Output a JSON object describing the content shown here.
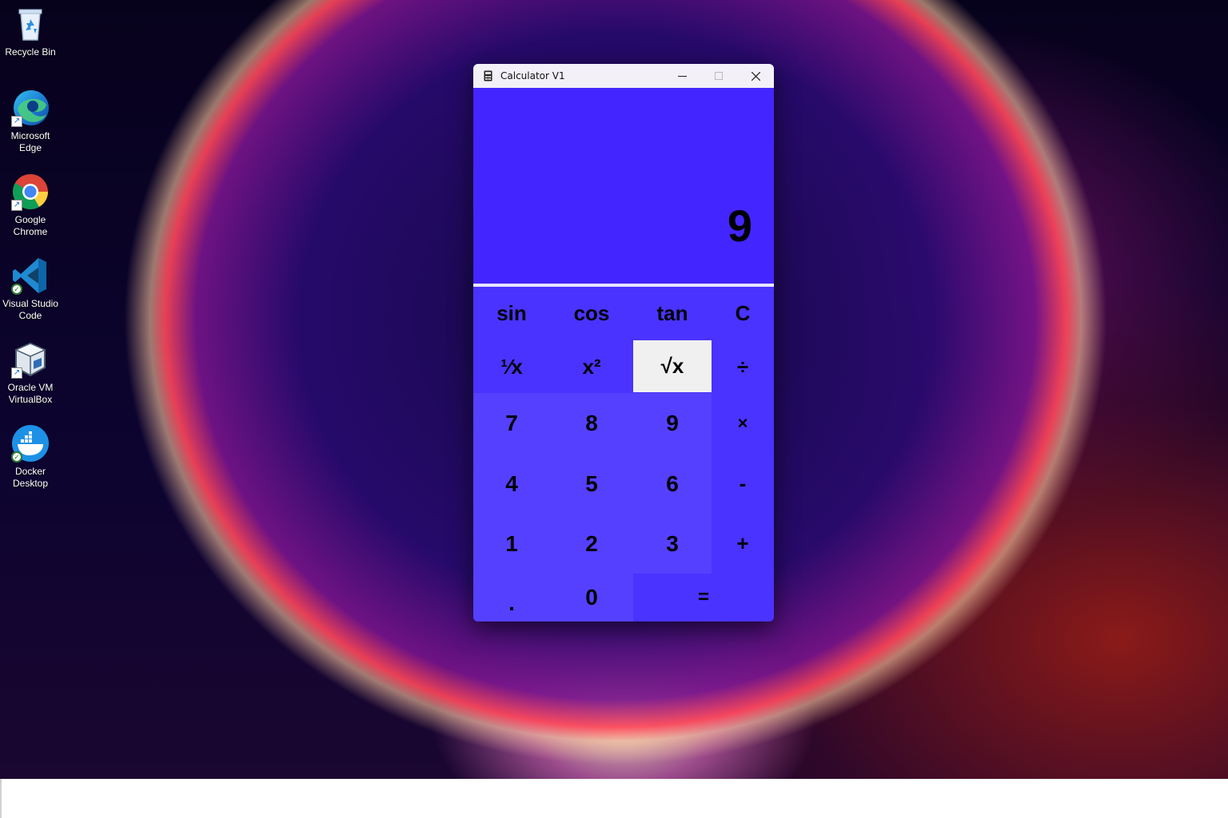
{
  "desktop": {
    "icons": [
      {
        "label": "Recycle Bin",
        "icon": "recycle-bin-icon"
      },
      {
        "label": "Microsoft Edge",
        "icon": "edge-icon"
      },
      {
        "label": "Google Chrome",
        "icon": "chrome-icon"
      },
      {
        "label": "Visual Studio Code",
        "icon": "vscode-icon"
      },
      {
        "label": "Oracle VM VirtualBox",
        "icon": "virtualbox-icon"
      },
      {
        "label": "Docker Desktop",
        "icon": "docker-icon"
      }
    ]
  },
  "window": {
    "title": "Calculator V1",
    "icon": "calculator-icon",
    "minimize": "—",
    "maximize": "☐",
    "close": "✕"
  },
  "display": {
    "value": "9"
  },
  "keys": {
    "sin": "sin",
    "cos": "cos",
    "tan": "tan",
    "clear": "C",
    "reciprocal": "¹⁄x",
    "square": "x²",
    "sqrt": "√x",
    "divide": "÷",
    "seven": "7",
    "eight": "8",
    "nine": "9",
    "multiply": "×",
    "four": "4",
    "five": "5",
    "six": "6",
    "minus": "-",
    "one": "1",
    "two": "2",
    "three": "3",
    "plus": "+",
    "dot": ".",
    "zero": "0",
    "equals": "="
  },
  "colors": {
    "display_bg": "#4326ff",
    "keypad_bg": "#4a33ff",
    "highlight_key": "#f0f0f0"
  }
}
